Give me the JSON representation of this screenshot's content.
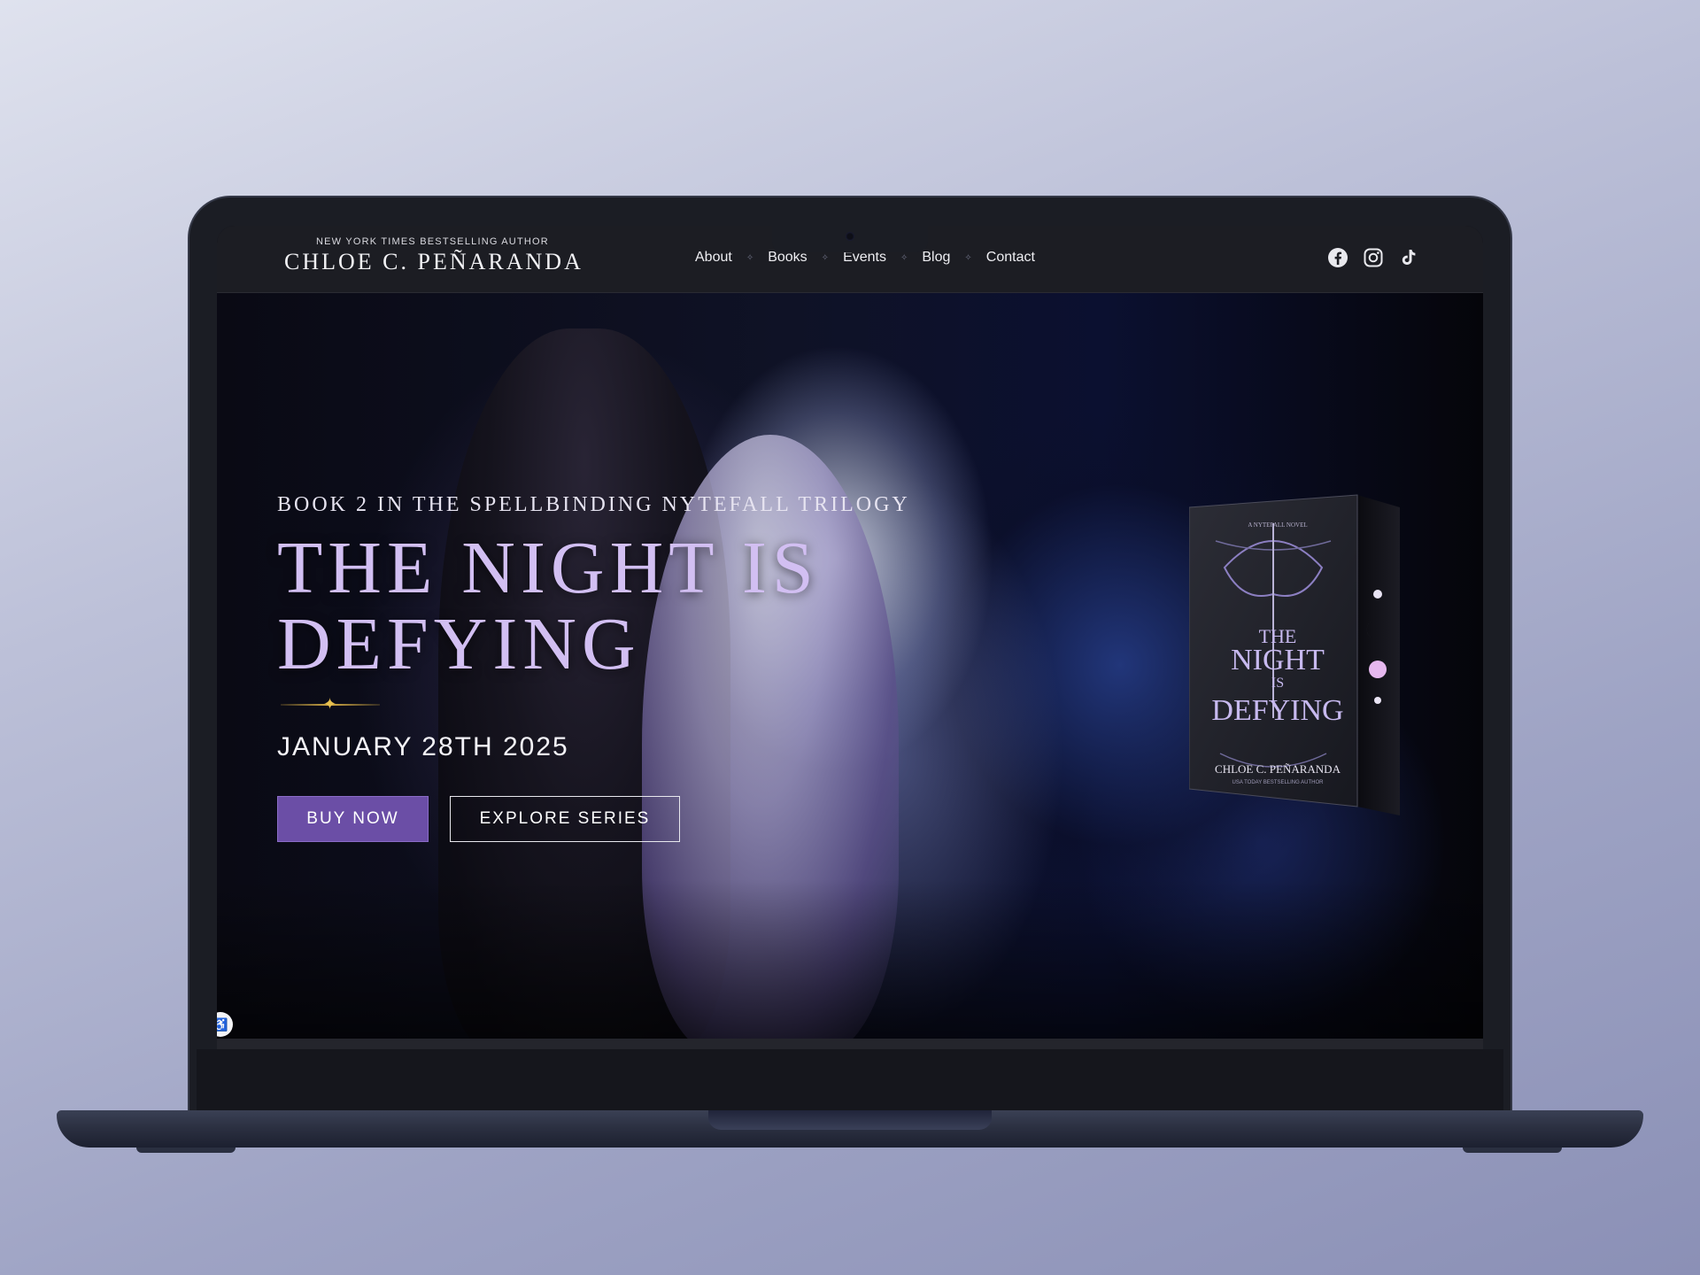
{
  "header": {
    "tagline": "NEW YORK TIMES BESTSELLING AUTHOR",
    "author_name": "CHLOE C. PEÑARANDA"
  },
  "nav": {
    "items": [
      {
        "label": "About"
      },
      {
        "label": "Books"
      },
      {
        "label": "Events"
      },
      {
        "label": "Blog"
      },
      {
        "label": "Contact"
      }
    ],
    "separator_glyph": "✧"
  },
  "socials": {
    "icons": [
      "facebook-icon",
      "instagram-icon",
      "tiktok-icon"
    ]
  },
  "hero": {
    "series_line": "BOOK 2 IN THE SPELLBINDING NYTEFALL TRILOGY",
    "title_line1": "THE NIGHT IS",
    "title_line2": "DEFYING",
    "release_date": "JANUARY 28TH 2025",
    "buy_label": "BUY NOW",
    "explore_label": "EXPLORE SERIES"
  },
  "book_cover": {
    "kicker": "A NYTEFALL NOVEL",
    "title_line1": "THE",
    "title_line2": "NIGHT",
    "title_line3": "IS",
    "title_line4": "DEFYING",
    "author": "CHLOE C. PEÑARANDA",
    "author_tag": "USA TODAY BESTSELLING AUTHOR"
  },
  "colors": {
    "accent_purple": "#6b4ea6",
    "title_lavender": "#d2bff2",
    "gold": "#d4ac45",
    "nav_bg": "#1c1d23"
  }
}
